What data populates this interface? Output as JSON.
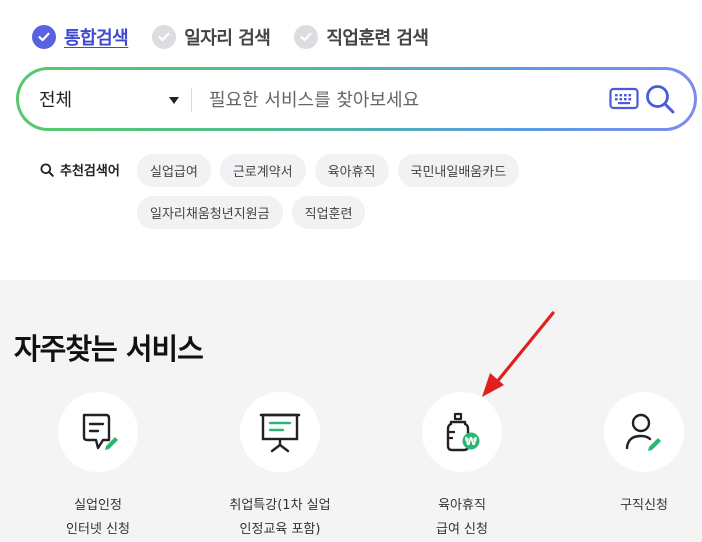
{
  "search_type_tabs": [
    {
      "label": "통합검색",
      "active": true
    },
    {
      "label": "일자리 검색",
      "active": false
    },
    {
      "label": "직업훈련 검색",
      "active": false
    }
  ],
  "search": {
    "scope_value": "전체",
    "placeholder": "필요한 서비스를 찾아보세요"
  },
  "recommended": {
    "label": "추천검색어",
    "keywords": [
      "실업급여",
      "근로계약서",
      "육아휴직",
      "국민내일배움카드",
      "일자리채움청년지원금",
      "직업훈련"
    ]
  },
  "frequent_services": {
    "title": "자주찾는 서비스",
    "items": [
      {
        "label": "실업인정\n인터넷 신청",
        "icon": "document-edit-icon"
      },
      {
        "label": "취업특강(1차 실업\n인정교육 포함)",
        "icon": "presentation-board-icon"
      },
      {
        "label": "육아휴직\n급여 신청",
        "icon": "baby-bottle-won-icon"
      },
      {
        "label": "구직신청",
        "icon": "person-edit-icon"
      }
    ]
  },
  "colors": {
    "accent_blue": "#5863e0",
    "accent_green": "#2cb673",
    "annotation_arrow": "#e0201f"
  }
}
